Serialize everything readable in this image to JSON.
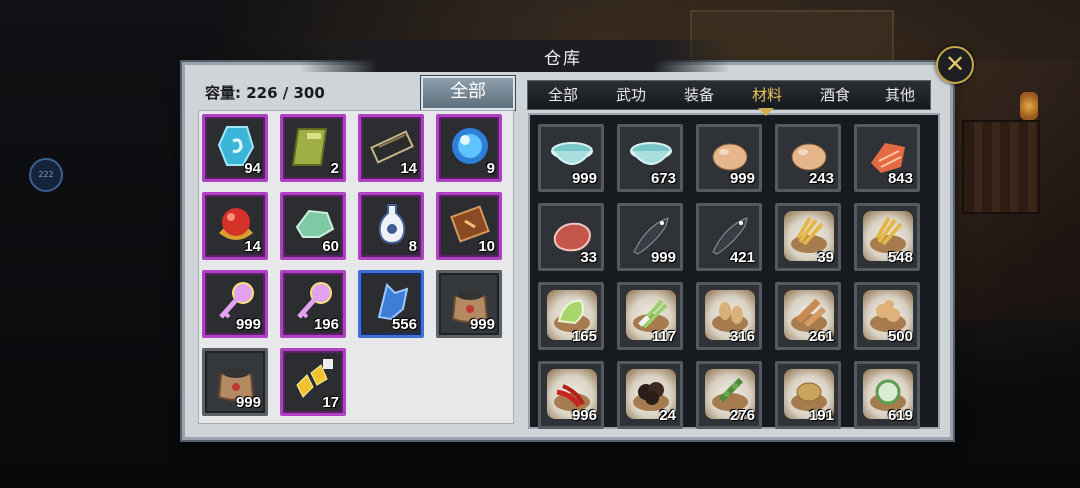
{
  "window": {
    "title": "仓库"
  },
  "capacity": "容量: 226 / 300",
  "filter_button": "全部",
  "tabs": [
    "全部",
    "武功",
    "装备",
    "材料",
    "酒食",
    "其他"
  ],
  "active_tab": "材料",
  "left_badge": "222",
  "left_items": [
    {
      "icon": "blue-crystal-icon",
      "qty": "94",
      "rarity": "purple"
    },
    {
      "icon": "green-book-icon",
      "qty": "2",
      "rarity": "purple"
    },
    {
      "icon": "black-scroll-icon",
      "qty": "14",
      "rarity": "purple"
    },
    {
      "icon": "blue-orb-icon",
      "qty": "9",
      "rarity": "purple"
    },
    {
      "icon": "red-pearl-icon",
      "qty": "14",
      "rarity": "purple"
    },
    {
      "icon": "jade-stone-icon",
      "qty": "60",
      "rarity": "purple"
    },
    {
      "icon": "porcelain-vase-icon",
      "qty": "8",
      "rarity": "purple"
    },
    {
      "icon": "wood-token-icon",
      "qty": "10",
      "rarity": "purple"
    },
    {
      "icon": "pink-key-icon",
      "qty": "999",
      "rarity": "purple"
    },
    {
      "icon": "pink-key-icon",
      "qty": "196",
      "rarity": "purple"
    },
    {
      "icon": "blue-crystal-shard-icon",
      "qty": "556",
      "rarity": "blue"
    },
    {
      "icon": "coal-sack-icon",
      "qty": "999",
      "rarity": "gray"
    },
    {
      "icon": "coal-sack-icon",
      "qty": "999",
      "rarity": "gray"
    },
    {
      "icon": "gold-fragment-icon",
      "qty": "17",
      "rarity": "purple"
    }
  ],
  "right_items": [
    {
      "icon": "bowl-icon",
      "qty": "999"
    },
    {
      "icon": "bowl-icon",
      "qty": "673"
    },
    {
      "icon": "egg-icon",
      "qty": "999"
    },
    {
      "icon": "egg-icon",
      "qty": "243"
    },
    {
      "icon": "salmon-icon",
      "qty": "843"
    },
    {
      "icon": "meat-icon",
      "qty": "33"
    },
    {
      "icon": "fish-icon",
      "qty": "999"
    },
    {
      "icon": "fish-icon",
      "qty": "421"
    },
    {
      "icon": "wheat-basket-icon",
      "qty": "39"
    },
    {
      "icon": "wheat-basket-icon",
      "qty": "548"
    },
    {
      "icon": "cabbage-basket-icon",
      "qty": "165"
    },
    {
      "icon": "scallion-basket-icon",
      "qty": "117"
    },
    {
      "icon": "peanut-basket-icon",
      "qty": "316"
    },
    {
      "icon": "yam-basket-icon",
      "qty": "261"
    },
    {
      "icon": "ginger-basket-icon",
      "qty": "500"
    },
    {
      "icon": "chili-basket-icon",
      "qty": "996"
    },
    {
      "icon": "mushroom-basket-icon",
      "qty": "24"
    },
    {
      "icon": "pepper-basket-icon",
      "qty": "276"
    },
    {
      "icon": "potato-basket-icon",
      "qty": "191"
    },
    {
      "icon": "melon-basket-icon",
      "qty": "619"
    }
  ]
}
